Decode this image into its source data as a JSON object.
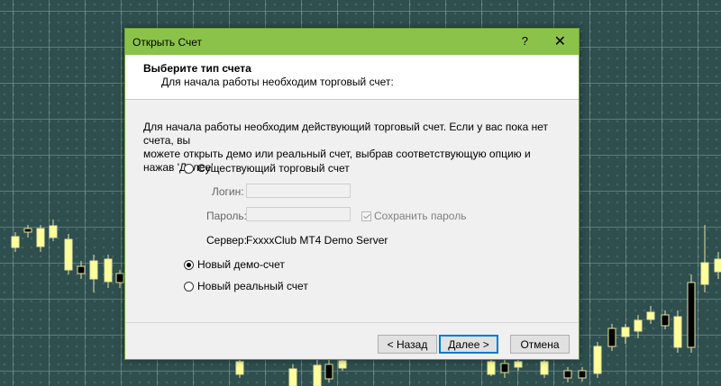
{
  "dialog": {
    "title": "Открыть Счет",
    "help_label": "?",
    "close_label": "✕",
    "header_title": "Выберите тип счета",
    "header_subtitle": "Для начала работы необходим торговый счет:",
    "description_line1": "Для начала работы необходим действующий торговый счет. Если у вас пока нет счета, вы",
    "description_line2": "можете открыть демо или реальный счет, выбрав соответствующую опцию и нажав 'Далее'",
    "options": [
      {
        "label": "Существующий торговый счет",
        "selected": false
      },
      {
        "label": "Новый демо-счет",
        "selected": true
      },
      {
        "label": "Новый реальный счет",
        "selected": false
      }
    ],
    "login_label": "Логин:",
    "password_label": "Пароль:",
    "save_password_label": "Сохранить пароль",
    "server_label": "Сервер:",
    "server_value": "FxxxxClub MT4 Demo Server",
    "buttons": {
      "back": "< Назад",
      "next": "Далее >",
      "cancel": "Отмена"
    }
  },
  "colors": {
    "titlebar": "#8bc34a",
    "background": "#2f4f4f",
    "candle_bull": "#ffffff",
    "candle_bear": "#000000",
    "candle_highlight": "#ffff99"
  }
}
